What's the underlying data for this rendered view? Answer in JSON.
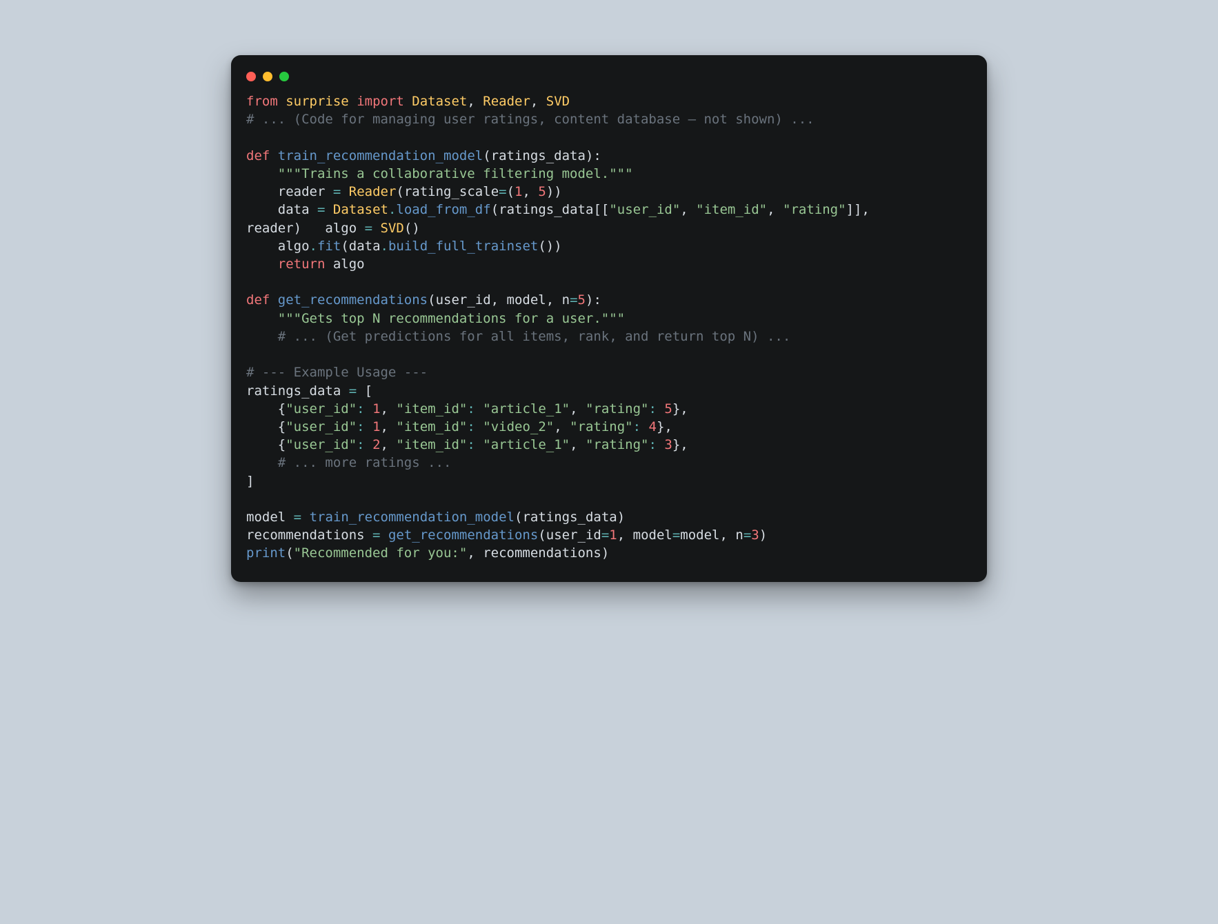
{
  "line1": {
    "from": "from",
    "mod": "surprise",
    "import": "import",
    "ds": "Dataset",
    "c1": ", ",
    "rd": "Reader",
    "c2": ", ",
    "svd": "SVD"
  },
  "line2": {
    "comment": "# ... (Code for managing user ratings, content database – not shown) ..."
  },
  "line4": {
    "def": "def",
    "sp": " ",
    "fn": "train_recommendation_model",
    "lp": "(",
    "arg": "ratings_data",
    "rp": "):"
  },
  "line5": {
    "indent": "    ",
    "doc": "\"\"\"Trains a collaborative filtering model.\"\"\""
  },
  "line6": {
    "indent": "    ",
    "reader": "reader",
    "sp1": " ",
    "eq": "=",
    "sp2": " ",
    "Reader": "Reader",
    "lp": "(",
    "kw": "rating_scale",
    "eq2": "=",
    "lp2": "(",
    "n1": "1",
    "c": ", ",
    "n5": "5",
    "rp2": ")",
    "rp": ")"
  },
  "line7": {
    "indent": "    ",
    "data": "data",
    "sp1": " ",
    "eq": "=",
    "sp2": " ",
    "Dataset": "Dataset",
    "dot": ".",
    "load": "load_from_df",
    "lp": "(",
    "rd": "ratings_data",
    "lb": "[[",
    "s1": "\"user_id\"",
    "c1": ", ",
    "s2": "\"item_id\"",
    "c2": ", ",
    "s3": "\"rating\"",
    "rb": "]]",
    "com": ","
  },
  "line8": {
    "readerw": "reader",
    "rp0": ")",
    "indent4": "   ",
    "algo": "algo",
    "sp1": " ",
    "eq": "=",
    "sp2": " ",
    "SVD": "SVD",
    "lp": "(",
    "rp": ")"
  },
  "line9": {
    "indent": "    ",
    "algo": "algo",
    "dot": ".",
    "fit": "fit",
    "lp": "(",
    "data": "data",
    "dot2": ".",
    "build": "build_full_trainset",
    "lp2": "(",
    "rp2": ")",
    "rp": ")"
  },
  "line10": {
    "indent": "    ",
    "ret": "return",
    "sp": " ",
    "algo": "algo"
  },
  "line12": {
    "def": "def",
    "sp": " ",
    "fn": "get_recommendations",
    "lp": "(",
    "a1": "user_id",
    "c1": ", ",
    "a2": "model",
    "c2": ", ",
    "a3": "n",
    "eq": "=",
    "n5": "5",
    "rp": "):"
  },
  "line13": {
    "indent": "    ",
    "doc": "\"\"\"Gets top N recommendations for a user.\"\"\""
  },
  "line14": {
    "indent": "    ",
    "comment": "# ... (Get predictions for all items, rank, and return top N) ..."
  },
  "line16": {
    "comment": "# --- Example Usage ---"
  },
  "line17": {
    "rd": "ratings_data",
    "sp1": " ",
    "eq": "=",
    "sp2": " ",
    "lb": "["
  },
  "line18": {
    "indent": "    ",
    "lb": "{",
    "k1": "\"user_id\"",
    "c1": ": ",
    "v1": "1",
    "com1": ", ",
    "k2": "\"item_id\"",
    "c2": ": ",
    "v2": "\"article_1\"",
    "com2": ", ",
    "k3": "\"rating\"",
    "c3": ": ",
    "v3": "5",
    "rb": "},"
  },
  "line19": {
    "indent": "    ",
    "lb": "{",
    "k1": "\"user_id\"",
    "c1": ": ",
    "v1": "1",
    "com1": ", ",
    "k2": "\"item_id\"",
    "c2": ": ",
    "v2": "\"video_2\"",
    "com2": ", ",
    "k3": "\"rating\"",
    "c3": ": ",
    "v3": "4",
    "rb": "},"
  },
  "line20": {
    "indent": "    ",
    "lb": "{",
    "k1": "\"user_id\"",
    "c1": ": ",
    "v1": "2",
    "com1": ", ",
    "k2": "\"item_id\"",
    "c2": ": ",
    "v2": "\"article_1\"",
    "com2": ", ",
    "k3": "\"rating\"",
    "c3": ": ",
    "v3": "3",
    "rb": "},"
  },
  "line21": {
    "indent": "    ",
    "comment": "# ... more ratings ..."
  },
  "line22": {
    "rb": "]"
  },
  "line24": {
    "model": "model",
    "sp1": " ",
    "eq": "=",
    "sp2": " ",
    "fn": "train_recommendation_model",
    "lp": "(",
    "arg": "ratings_data",
    "rp": ")"
  },
  "line25": {
    "rec": "recommendations",
    "sp1": " ",
    "eq": "=",
    "sp2": " ",
    "fn": "get_recommendations",
    "lp": "(",
    "k1": "user_id",
    "eq1": "=",
    "v1": "1",
    "c1": ", ",
    "k2": "model",
    "eq2": "=",
    "v2": "model",
    "c2": ", ",
    "k3": "n",
    "eq3": "=",
    "v3": "3",
    "rp": ")"
  },
  "line26": {
    "print": "print",
    "lp": "(",
    "s": "\"Recommended for you:\"",
    "c": ", ",
    "rec": "recommendations",
    "rp": ")"
  }
}
